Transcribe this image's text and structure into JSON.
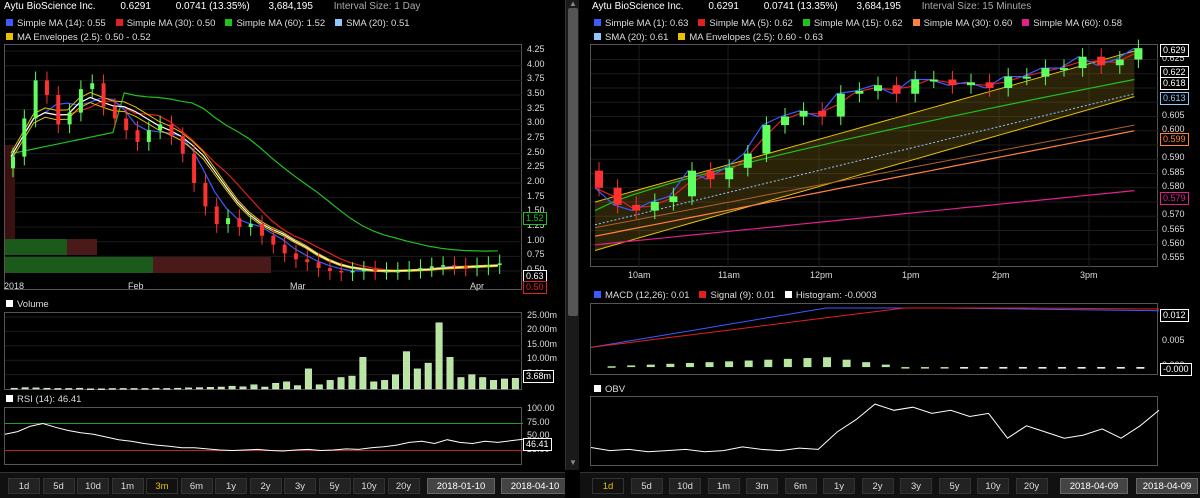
{
  "left": {
    "header": {
      "name": "Aytu BioScience Inc.",
      "price": "0.6291",
      "change": "0.0741 (13.35%)",
      "volume": "3,684,195",
      "interval": "Interval Size:  1 Day"
    },
    "legend1": [
      {
        "label": "Simple MA (14): 0.55",
        "color": "#3a5cff"
      },
      {
        "label": "Simple MA (30): 0.50",
        "color": "#e02020"
      },
      {
        "label": "Simple MA (60): 1.52",
        "color": "#20c020"
      },
      {
        "label": "SMA (20): 0.51",
        "color": "#8fc8ff"
      }
    ],
    "legend2": [
      {
        "label": "MA Envelopes (2.5): 0.50 - 0.52",
        "color": "#e6c200"
      }
    ],
    "price_ticks": [
      "4.25",
      "4.00",
      "3.75",
      "3.50",
      "3.25",
      "3.00",
      "2.75",
      "2.50",
      "2.25",
      "2.00",
      "1.75",
      "1.50",
      "1.25",
      "1.00",
      "0.75",
      "0.50"
    ],
    "price_tags": [
      {
        "text": "1.52",
        "color": "#20c020"
      },
      {
        "text": "0.63",
        "color": "#fff"
      },
      {
        "text": "0.50",
        "color": "#e02020"
      }
    ],
    "x_labels": [
      "2018",
      "Feb",
      "Mar",
      "Apr"
    ],
    "volume_label": "Volume",
    "volume_ticks": [
      "25.00m",
      "20.00m",
      "15.00m",
      "10.00m",
      "5.00m"
    ],
    "volume_tag": "3.68m",
    "rsi_label": "RSI (14): 46.41",
    "rsi_ticks": [
      "100.00",
      "75.00",
      "50.00",
      "25.00"
    ],
    "rsi_tag": "46.41",
    "buttons": [
      "1d",
      "5d",
      "10d",
      "1m",
      "3m",
      "6m",
      "1y",
      "2y",
      "3y",
      "5y",
      "10y",
      "20y"
    ],
    "active": "3m",
    "date_from": "2018-01-10",
    "date_to": "2018-04-10"
  },
  "right": {
    "header": {
      "name": "Aytu BioScience Inc.",
      "price": "0.6291",
      "change": "0.0741 (13.35%)",
      "volume": "3,684,195",
      "interval": "Interval Size:  15 Minutes"
    },
    "legend1": [
      {
        "label": "Simple MA (1): 0.63",
        "color": "#3a5cff"
      },
      {
        "label": "Simple MA (5): 0.62",
        "color": "#e02020"
      },
      {
        "label": "Simple MA (15): 0.62",
        "color": "#20c020"
      },
      {
        "label": "Simple MA (30): 0.60",
        "color": "#ff8040"
      },
      {
        "label": "Simple MA (60): 0.58",
        "color": "#e0208c"
      }
    ],
    "legend2": [
      {
        "label": "SMA (20): 0.61",
        "color": "#8fc8ff"
      },
      {
        "label": "MA Envelopes (2.5): 0.60 - 0.63",
        "color": "#e6c200"
      }
    ],
    "price_ticks": [
      "0.625",
      "0.620",
      "0.615",
      "0.610",
      "0.605",
      "0.600",
      "0.595",
      "0.590",
      "0.585",
      "0.580",
      "0.575",
      "0.570",
      "0.565",
      "0.560",
      "0.555"
    ],
    "price_tags": [
      {
        "text": "0.629",
        "color": "#fff"
      },
      {
        "text": "0.622",
        "color": "#fff"
      },
      {
        "text": "0.618",
        "color": "#fff"
      },
      {
        "text": "0.613",
        "color": "#8fc8ff"
      },
      {
        "text": "0.599",
        "color": "#ff8040"
      },
      {
        "text": "0.579",
        "color": "#e0208c"
      }
    ],
    "x_labels": [
      "10am",
      "11am",
      "12pm",
      "1pm",
      "2pm",
      "3pm"
    ],
    "macd_legend": [
      {
        "label": "MACD (12,26): 0.01",
        "color": "#3a5cff"
      },
      {
        "label": "Signal (9): 0.01",
        "color": "#e02020"
      },
      {
        "label": "Histogram: -0.0003",
        "color": "#fff"
      }
    ],
    "macd_ticks": [
      "0.010",
      "0.005",
      "0.000"
    ],
    "macd_tags": [
      "0.012",
      "-0.000"
    ],
    "obv_label": "OBV",
    "buttons": [
      "1d",
      "5d",
      "10d",
      "1m",
      "3m",
      "6m",
      "1y",
      "2y",
      "3y",
      "5y",
      "10y",
      "20y"
    ],
    "active": "1d",
    "date_from": "2018-04-09",
    "date_to": "2018-04-09"
  },
  "chart_data": [
    {
      "type": "candlestick",
      "title": "Aytu BioScience Inc. 1 Day",
      "ylim": [
        0.5,
        4.25
      ],
      "close": [
        2.45,
        3.1,
        3.75,
        3.5,
        3.0,
        3.2,
        3.6,
        3.7,
        3.3,
        3.1,
        2.9,
        2.7,
        2.9,
        3.0,
        2.8,
        2.5,
        2.0,
        1.6,
        1.3,
        1.4,
        1.25,
        1.3,
        1.1,
        0.95,
        0.8,
        0.7,
        0.65,
        0.55,
        0.5,
        0.48,
        0.5,
        0.52,
        0.5,
        0.5,
        0.5,
        0.52,
        0.55,
        0.58,
        0.6,
        0.58,
        0.56,
        0.58,
        0.6,
        0.63
      ]
    },
    {
      "type": "candlestick",
      "title": "Aytu BioScience Inc. 15 Minutes",
      "ylim": [
        0.555,
        0.63
      ],
      "close": [
        0.58,
        0.574,
        0.572,
        0.575,
        0.577,
        0.586,
        0.583,
        0.587,
        0.592,
        0.602,
        0.605,
        0.607,
        0.605,
        0.613,
        0.614,
        0.616,
        0.613,
        0.618,
        0.618,
        0.616,
        0.617,
        0.615,
        0.619,
        0.619,
        0.622,
        0.622,
        0.626,
        0.623,
        0.625,
        0.629
      ]
    }
  ]
}
